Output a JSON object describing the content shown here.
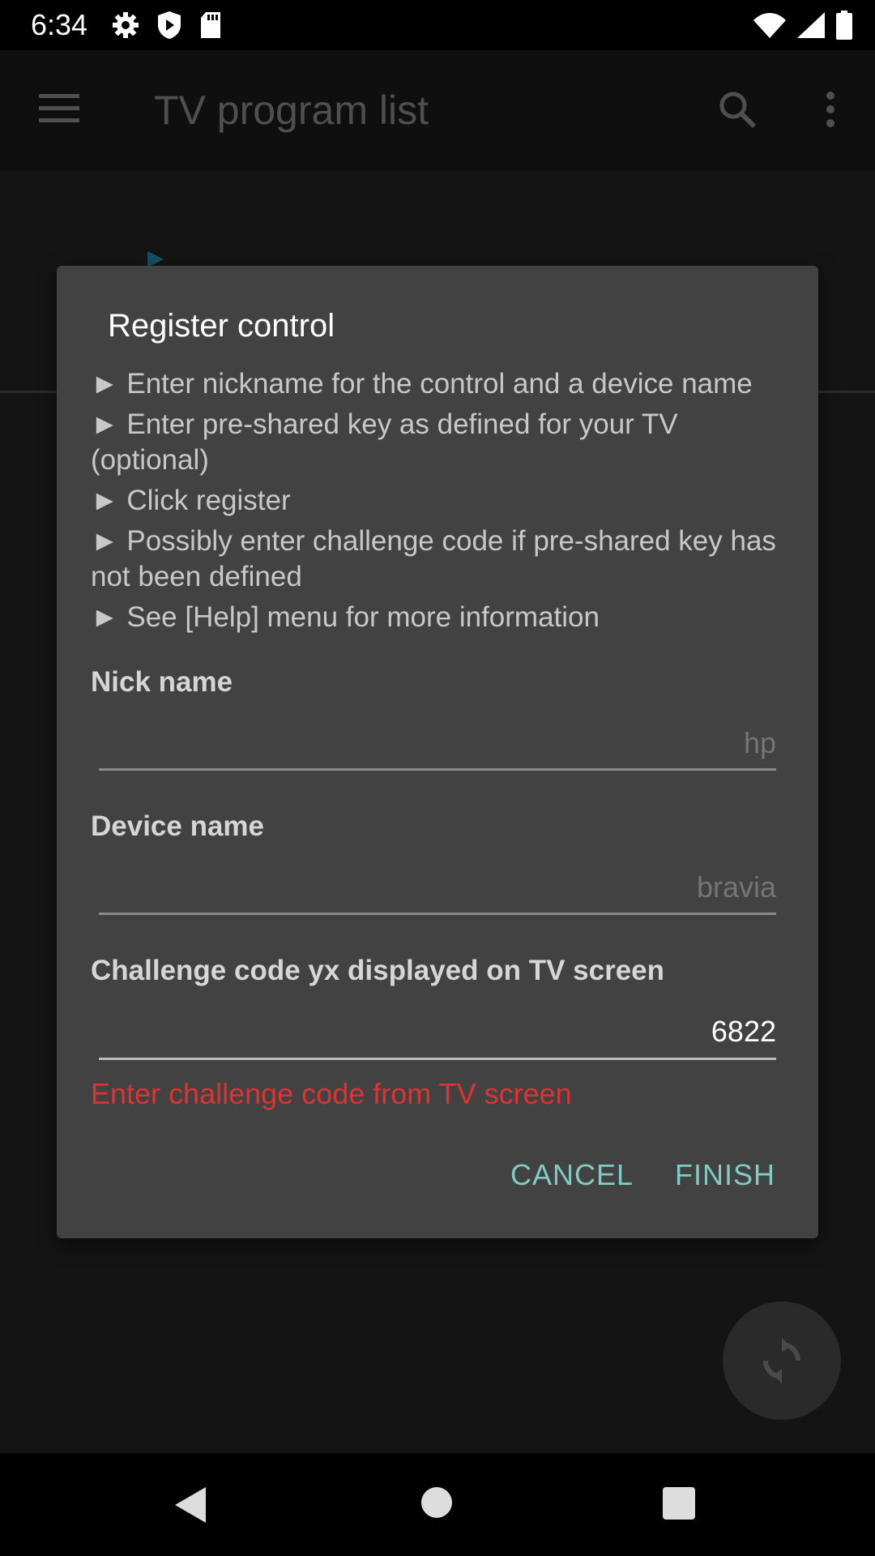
{
  "status_bar": {
    "time": "6:34",
    "left_icons": [
      "gear-icon",
      "shield-play-icon",
      "sd-card-icon"
    ],
    "right_icons": [
      "wifi-icon",
      "signal-icon",
      "battery-icon"
    ]
  },
  "app_bar": {
    "title": "TV program list",
    "icons": [
      "menu-icon",
      "search-icon",
      "more-vert-icon"
    ]
  },
  "dialog": {
    "title": "Register control",
    "instructions": [
      "► Enter nickname for the control and a device name",
      "► Enter pre-shared key as defined for your TV (optional)",
      "► Click register",
      "► Possibly enter challenge code if pre-shared key has not been defined",
      "► See [Help] menu for more information"
    ],
    "fields": {
      "nick_name": {
        "label": "Nick name",
        "placeholder": "hp",
        "value": ""
      },
      "device_name": {
        "label": "Device name",
        "placeholder": "bravia",
        "value": ""
      },
      "challenge_code": {
        "label": "Challenge code yx displayed on TV screen",
        "placeholder": "",
        "value": "6822"
      }
    },
    "error": "Enter challenge code from TV screen",
    "buttons": {
      "cancel": "CANCEL",
      "finish": "FINISH"
    }
  },
  "fab": {
    "icon": "sync-icon"
  },
  "nav_bar": {
    "icons": [
      "back-icon",
      "home-icon",
      "recents-icon"
    ]
  },
  "colors": {
    "accent": "#80cbc4",
    "error": "#dd3333",
    "dialog_bg": "#424242"
  }
}
